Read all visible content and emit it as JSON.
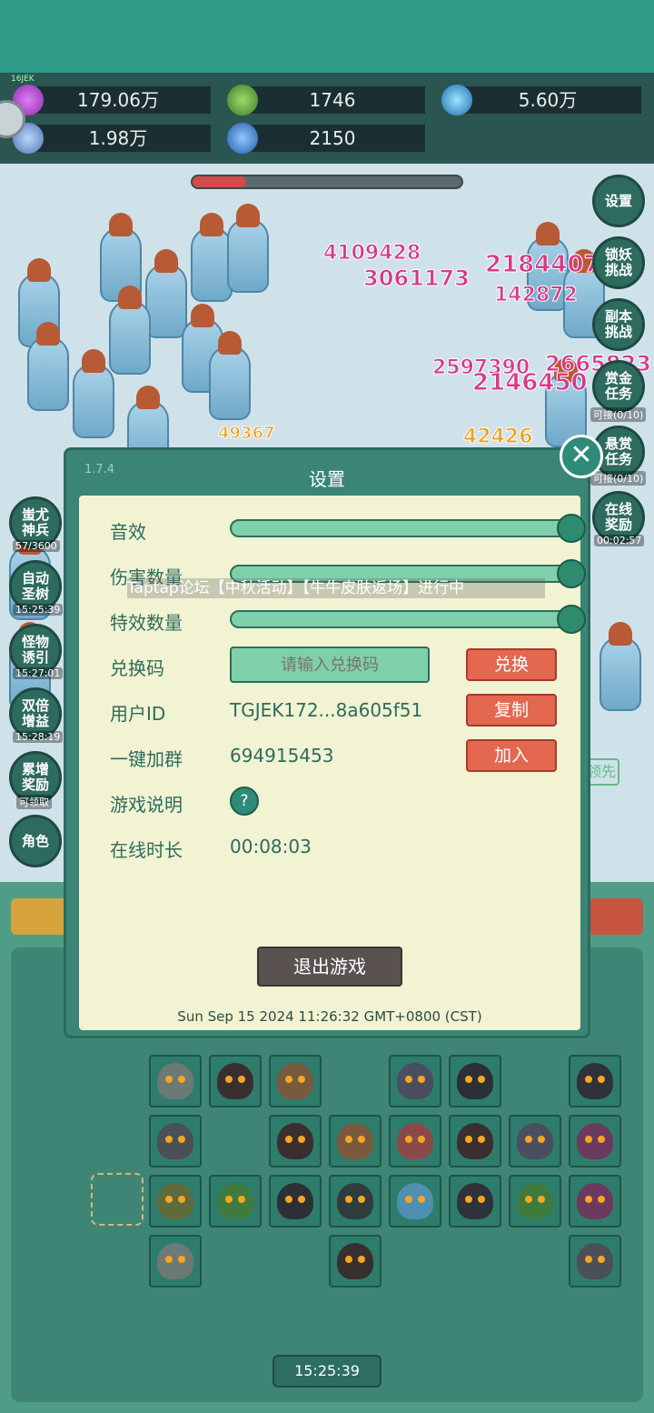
{
  "resources": {
    "gem": "179.06万",
    "green_crystal": "1746",
    "orb": "5.60万",
    "scroll": "1.98万",
    "blue_crystal": "2150",
    "tag": "16JEK"
  },
  "right_buttons": [
    {
      "label": "设置",
      "sub": ""
    },
    {
      "label": "锁妖\n挑战",
      "sub": ""
    },
    {
      "label": "副本\n挑战",
      "sub": ""
    },
    {
      "label": "赏金\n任务",
      "sub": "可接(0/10)"
    },
    {
      "label": "悬赏\n任务",
      "sub": "可接(0/10)"
    },
    {
      "label": "在线\n奖励",
      "sub": "00:02:57"
    }
  ],
  "left_buttons": [
    {
      "label": "蚩尤\n神兵",
      "sub": "57/3600"
    },
    {
      "label": "自动\n圣树",
      "sub": "15:25:39"
    },
    {
      "label": "怪物\n诱引",
      "sub": "15:27:01"
    },
    {
      "label": "双倍\n增益",
      "sub": "15:28:19"
    },
    {
      "label": "累增\n奖励",
      "sub": "可领取"
    },
    {
      "label": "角色",
      "sub": ""
    }
  ],
  "damage_numbers": [
    "4109428",
    "3061173",
    "2184407",
    "142872",
    "2597390",
    "2665823",
    "2146450",
    "42426",
    "49367"
  ],
  "settings": {
    "version": "1.7.4",
    "title": "设置",
    "sound_label": "音效",
    "sound_level": 1.0,
    "damage_count_label": "伤害数量",
    "damage_count_level": 1.0,
    "effects_count_label": "特效数量",
    "effects_count_level": 1.0,
    "redeem_label": "兑换码",
    "redeem_placeholder": "请输入兑换码",
    "redeem_button": "兑换",
    "user_id_label": "用户ID",
    "user_id_value": "TGJEK172...8a605f51",
    "copy_button": "复制",
    "group_label": "一键加群",
    "group_value": "694915453",
    "join_button": "加入",
    "guide_label": "游戏说明",
    "guide_icon": "?",
    "online_label": "在线时长",
    "online_value": "00:08:03",
    "exit_button": "退出游戏",
    "datetime": "Sun Sep 15 2024 11:26:32 GMT+0800 (CST)"
  },
  "marquee": "Taptap论坛【中秋活动】【牛牛皮肤返场】进行中",
  "bottom": {
    "help": "?",
    "clock": "15:25:39",
    "side_label": "领先"
  },
  "colors": {
    "accent": "#2f9a86",
    "panel": "#f1f3d2",
    "button_red": "#e4674f",
    "slider": "#7fd0a8"
  }
}
